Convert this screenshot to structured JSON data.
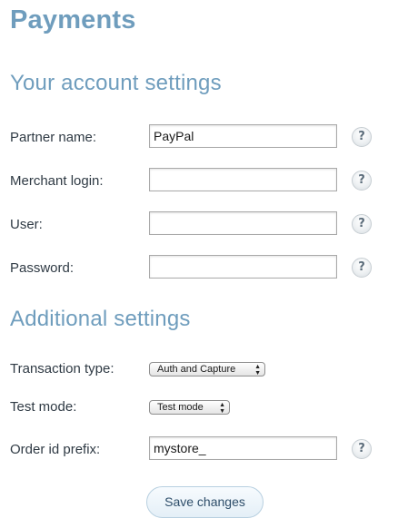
{
  "page": {
    "title": "Payments"
  },
  "account_settings": {
    "heading": "Your account settings",
    "fields": [
      {
        "label": "Partner name:",
        "value": "PayPal",
        "help_icon": "question-mark"
      },
      {
        "label": "Merchant login:",
        "value": "",
        "help_icon": "question-mark"
      },
      {
        "label": "User:",
        "value": "",
        "help_icon": "question-mark"
      },
      {
        "label": "Password:",
        "value": "",
        "help_icon": "question-mark"
      }
    ]
  },
  "additional_settings": {
    "heading": "Additional settings",
    "transaction_type": {
      "label": "Transaction type:",
      "selected": "Auth and Capture"
    },
    "test_mode": {
      "label": "Test mode:",
      "selected": "Test mode"
    },
    "order_id_prefix": {
      "label": "Order id prefix:",
      "value": "mystore_",
      "help_icon": "question-mark"
    }
  },
  "help_symbol": "?",
  "actions": {
    "save_label": "Save changes"
  },
  "colors": {
    "heading": "#6f9dbd",
    "text": "#2f3a44",
    "button_text": "#2e4e6a"
  }
}
